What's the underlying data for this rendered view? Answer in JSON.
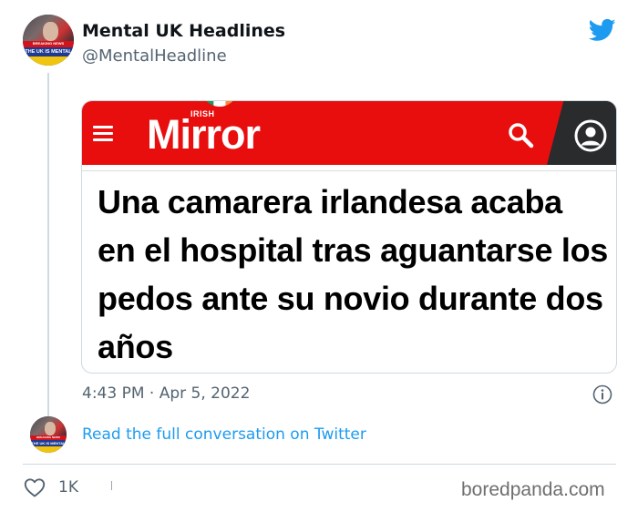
{
  "author": {
    "name": "Mental UK Headlines",
    "handle": "@MentalHeadline",
    "avatar_banner_top": "BREAKING NEWS",
    "avatar_banner": "THE UK IS MENTAL"
  },
  "card": {
    "site": {
      "logo_word": "Mirror",
      "logo_prefix": "IRISH",
      "brand_color": "#e90e0e"
    },
    "headline": "Una camarera irlandesa acaba en el hospital tras aguantarse los pedos ante su novio durante dos años"
  },
  "timestamp": "4:43 PM · Apr 5, 2022",
  "read_more": "Read the full conversation on Twitter",
  "actions": {
    "like_count": "1K"
  },
  "watermark": "boredpanda.com",
  "icons": {
    "bird": "twitter-bird-icon",
    "info": "info-icon",
    "heart": "heart-icon",
    "menu": "menu-icon",
    "search": "search-icon",
    "user": "user-icon"
  },
  "colors": {
    "twitter_blue": "#1d9bf0",
    "muted_text": "#536471",
    "border": "#cfd9de"
  }
}
